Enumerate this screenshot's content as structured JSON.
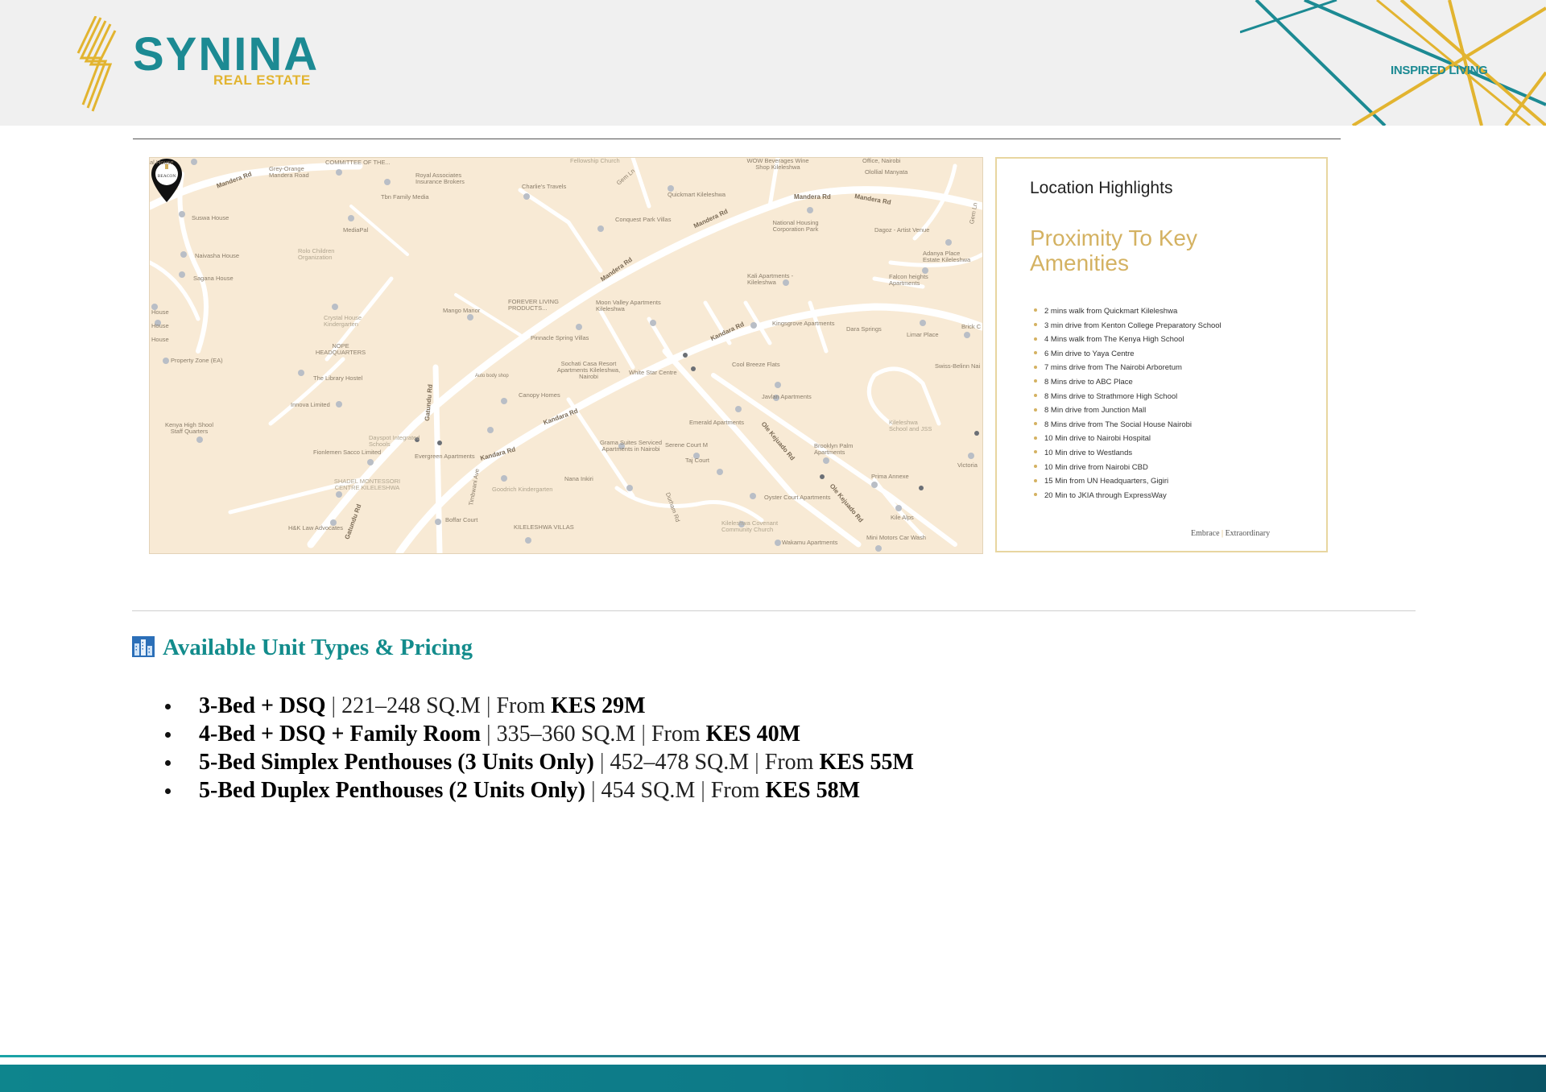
{
  "header": {
    "brand_name": "SYNINA",
    "brand_sub": "REAL ESTATE",
    "tagline": "INSPIRED LIVING"
  },
  "map": {
    "pin_label": "BEACON",
    "labels": [
      "Mandera Rd",
      "Mandera Rd",
      "Mandera Rd",
      "Mandera Rd",
      "Mandera Rd",
      "Kandara Rd",
      "Kandara Rd",
      "Kandara Rd",
      "Gatundu Rd",
      "Gatundu Rd",
      "Ole Kejuado Rd",
      "Ole Kejuado Rd",
      "Durham Rd",
      "Timbwani Ave",
      "Gem Ln",
      "Gem Ln",
      "COMMITTEE OF THE...",
      "Grey-Orange Mandera Road",
      "Royal Associates Insurance Brokers",
      "Charlie's Travels",
      "Tbn Family Media",
      "Suswa House",
      "MediaPal",
      "Naivasha House",
      "Sagana House",
      "Crystal House Kindergarten",
      "Mango Manor",
      "FOREVER LIVING PRODUCTS...",
      "Pinnacle Spring Villas",
      "Moon Valley Apartments Kileleshwa",
      "NOPE HEADQUARTERS",
      "The Library Hostel",
      "Innova Limited",
      "Property Zone (EA)",
      "Kenya High Shool Staff Quarters",
      "Fionlemen Sacco Limited",
      "Dayspot Integrated Schools",
      "SHADEL MONTESSORI CENTRE KILELESHWA",
      "Evergreen Apartments",
      "Auto body shop",
      "Canopy Homes",
      "Sochati Casa Resort Apartments Kileleshwa, Nairobi",
      "White Star Centre",
      "Grama Suites Serviced Apartments in Nairobi",
      "Serene Court M",
      "Taj Court",
      "Nana Inkiri",
      "Goodrich Kindergarten",
      "Boffar Court",
      "KILELESHWA VILLAS",
      "H&K Law Advocates",
      "Emerald Apartments",
      "Javlan Apartments",
      "Cool Breeze Flats",
      "Kingsgrove Apartments",
      "Dara Springs",
      "Limar Place",
      "Kali Apartments - Kileleshwa",
      "Falcon heights Apartments",
      "Adanya Place Estate Kileleshwa",
      "Dagoz - Artist Venue",
      "National Housing Corporation Park",
      "Quickmart Kileleshwa",
      "Conquest Park Villas",
      "WOW Beverages Wine Shop Kileleshwa",
      "Office, Nairobi",
      "Olollial Manyata",
      "Brooklyn Palm Apartments",
      "Prima Annexe",
      "Kileleshwa School and JSS",
      "Oyster Court Apartments",
      "Kileleshwa Covenant Community Church",
      "Wakamu Apartments",
      "Mini Motors Car Wash",
      "Kile Alps",
      "Swiss-Belinn Nai",
      "Brick C",
      "Victoria",
      "Fellowship Church",
      "Rolo Children Organization",
      "House",
      "House",
      "House",
      "al House"
    ]
  },
  "highlights": {
    "title": "Location Highlights",
    "subtitle": "Proximity To Key Amenities",
    "items": [
      "2 mins walk from Quickmart Kileleshwa",
      "3 min drive from Kenton College Preparatory School",
      "4 Mins walk from The Kenya High School",
      "6 Min drive to Yaya Centre",
      "7 mins drive from The Nairobi Arboretum",
      "8 Mins drive to ABC Place",
      "8 Mins drive to Strathmore High School",
      "8 Min drive from Junction Mall",
      "8 Mins drive from The Social House Nairobi",
      "10 Min drive to Nairobi Hospital",
      "10 Min drive to Westlands",
      "10 Min drive from Nairobi CBD",
      "15 Min from UN Headquarters, Gigiri",
      "20 Min to JKIA through ExpressWay"
    ],
    "footer_left": "Embrace",
    "footer_mid": "|",
    "footer_right": "Extraordinary"
  },
  "pricing": {
    "title": "Available Unit Types & Pricing",
    "units": [
      {
        "name": "3-Bed + DSQ",
        "size": "221–248 SQ.M",
        "from": "From",
        "price": "KES 29M"
      },
      {
        "name": "4-Bed + DSQ + Family Room",
        "size": "335–360 SQ.M",
        "from": "From",
        "price": "KES 40M"
      },
      {
        "name": "5-Bed Simplex Penthouses (3 Units Only)",
        "size": "452–478 SQ.M",
        "from": "From",
        "price": "KES 55M"
      },
      {
        "name": "5-Bed Duplex Penthouses (2 Units Only)",
        "size": "454 SQ.M",
        "from": "From",
        "price": "KES 58M"
      }
    ]
  },
  "colors": {
    "teal": "#138c8c",
    "gold": "#d4b262",
    "header_bg": "#f0f0f0",
    "map_bg": "#f8ead5"
  }
}
